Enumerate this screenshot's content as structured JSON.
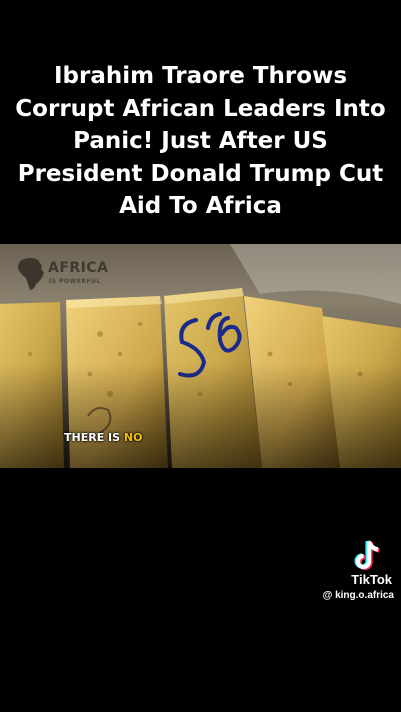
{
  "headline": {
    "lines": [
      "Ibrahim Traore Throws",
      "Corrupt African Leaders Into",
      "Panic! Just After US",
      "President Donald Trump Cut",
      "Aid To Africa"
    ]
  },
  "video": {
    "watermark": {
      "title": "AFRICA",
      "subtitle": "IS POWERFUL"
    },
    "caption": {
      "text": "THERE IS ",
      "highlight": "NO"
    },
    "bar_markings": "56",
    "colors": {
      "gold": "#c9a64a",
      "caption_highlight": "#f2c200"
    }
  },
  "tiktok": {
    "icon": "tiktok-icon",
    "label": "TikTok",
    "handle": "@ king.o.africa"
  }
}
